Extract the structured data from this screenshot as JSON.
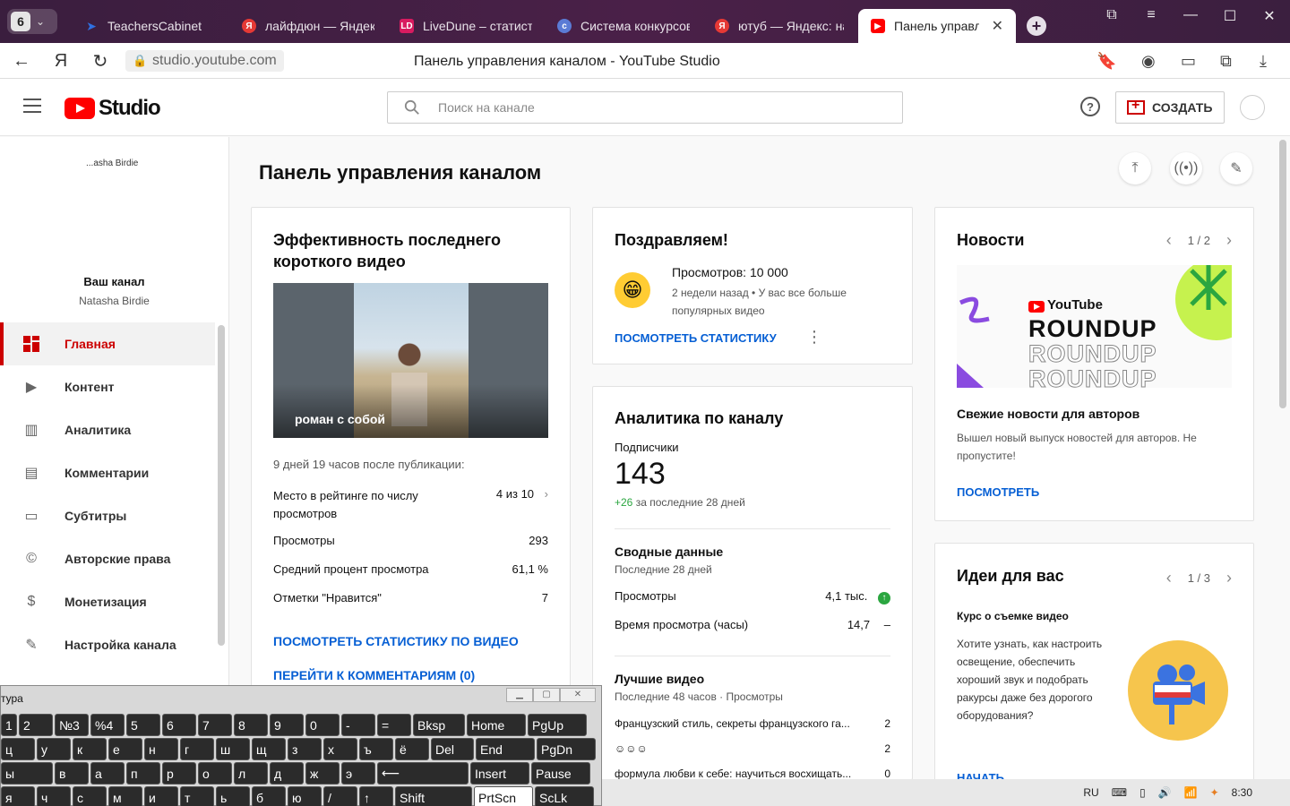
{
  "browser": {
    "tab_count": "6",
    "tabs": [
      {
        "label": "TeachersCabinet",
        "fav_color": "#2f6fe0"
      },
      {
        "label": "лайфдюн — Яндекс: н",
        "fav_color": "#e53935"
      },
      {
        "label": "LiveDune – статистика",
        "fav_color": "#d81b60"
      },
      {
        "label": "Система конкурсов",
        "fav_color": "#5b7bd5"
      },
      {
        "label": "ютуб — Яндекс: нашл",
        "fav_color": "#e53935"
      },
      {
        "label": "Панель управлени",
        "fav_color": "#ff0000"
      }
    ],
    "url": "studio.youtube.com",
    "page_title": "Панель управления каналом - YouTube Studio"
  },
  "header": {
    "logo_text": "Studio",
    "search_placeholder": "Поиск на канале",
    "help": "?",
    "create_label": "СОЗДАТЬ"
  },
  "sidebar": {
    "channel_top": "...asha Birdie",
    "your_channel": "Ваш канал",
    "channel_name": "Natasha Birdie",
    "items": [
      {
        "label": "Главная",
        "icon": "dashboard-icon"
      },
      {
        "label": "Контент",
        "icon": "content-icon"
      },
      {
        "label": "Аналитика",
        "icon": "analytics-icon"
      },
      {
        "label": "Комментарии",
        "icon": "comments-icon"
      },
      {
        "label": "Субтитры",
        "icon": "subtitles-icon"
      },
      {
        "label": "Авторские права",
        "icon": "copyright-icon"
      },
      {
        "label": "Монетизация",
        "icon": "monetization-icon"
      },
      {
        "label": "Настройка канала",
        "icon": "customization-icon"
      }
    ]
  },
  "main": {
    "title": "Панель управления каналом",
    "short_card": {
      "title": "Эффективность последнего короткого видео",
      "video_caption": "роман с собой",
      "since": "9 дней 19 часов после публикации:",
      "rank_label": "Место в рейтинге по числу просмотров",
      "rank_value": "4 из 10",
      "views_label": "Просмотры",
      "views_value": "293",
      "avg_label": "Средний процент просмотра",
      "avg_value": "61,1 %",
      "likes_label": "Отметки \"Нравится\"",
      "likes_value": "7",
      "link_stats": "ПОСМОТРЕТЬ СТАТИСТИКУ ПО ВИДЕО",
      "link_comments": "ПЕРЕЙТИ К КОММЕНТАРИЯМ (0)"
    },
    "congrats_card": {
      "title": "Поздравляем!",
      "headline": "Просмотров: 10 000",
      "sub": "2 недели назад • У вас все больше популярных видео",
      "link": "ПОСМОТРЕТЬ СТАТИСТИКУ"
    },
    "analytics_card": {
      "title": "Аналитика по каналу",
      "subs_label": "Подписчики",
      "subs_value": "143",
      "subs_delta": "+26",
      "subs_delta_suffix": " за последние 28 дней",
      "summary_title": "Сводные данные",
      "summary_period": "Последние 28 дней",
      "views_label": "Просмотры",
      "views_value": "4,1 тыс.",
      "watch_label": "Время просмотра (часы)",
      "watch_value": "14,7",
      "watch_trend": "–",
      "top_title": "Лучшие видео",
      "top_period": "Последние 48 часов · Просмотры",
      "top_videos": [
        {
          "title": "Французский стиль, секреты французского га...",
          "views": "2"
        },
        {
          "title": "☺☺☺",
          "views": "2"
        },
        {
          "title": "формула любви к себе: научиться восхищать...",
          "views": "0"
        }
      ]
    },
    "news_card": {
      "title": "Новости",
      "pager": "1 / 2",
      "brand": "YouTube",
      "roundup": "ROUNDUP",
      "headline": "Свежие новости для авторов",
      "body": "Вышел новый выпуск новостей для авторов. Не пропустите!",
      "link": "ПОСМОТРЕТЬ"
    },
    "ideas_card": {
      "title": "Идеи для вас",
      "pager": "1 / 3",
      "subtitle": "Курс о съемке видео",
      "body": "Хотите узнать, как настроить освещение, обеспечить хороший звук и подобрать ракурсы даже без дорогого оборудования?",
      "link": "НАЧАТЬ"
    }
  },
  "keyboard": {
    "title": "тура",
    "rows": [
      [
        "1",
        "2",
        "№3",
        "%4",
        "5",
        "6",
        "7",
        "8",
        "9",
        "0",
        "-",
        "=",
        "Bksp",
        "Home",
        "PgUp"
      ],
      [
        "ц",
        "у",
        "к",
        "е",
        "н",
        "г",
        "ш",
        "щ",
        "з",
        "х",
        "ъ",
        "ё",
        "Del",
        "End",
        "PgDn"
      ],
      [
        "ы",
        "в",
        "а",
        "п",
        "р",
        "о",
        "л",
        "д",
        "ж",
        "э",
        "⟵",
        "Insert",
        "Pause"
      ],
      [
        "я",
        "ч",
        "с",
        "м",
        "и",
        "т",
        "ь",
        "б",
        "ю",
        "/",
        "↑",
        "Shift",
        "PrtScn",
        "ScLk"
      ]
    ]
  },
  "taskbar": {
    "lang": "RU",
    "time": "8:30"
  }
}
